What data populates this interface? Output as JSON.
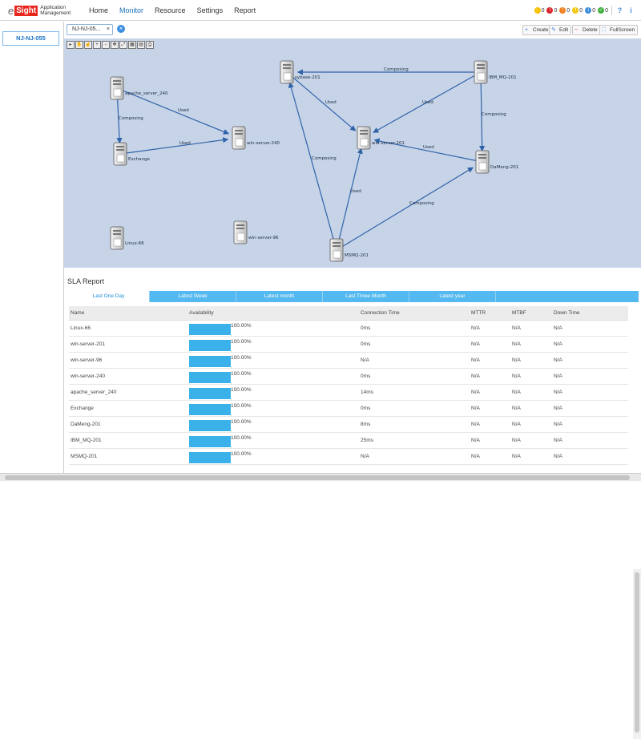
{
  "app": {
    "logo_prefix": "e",
    "logo_brand": "Sight",
    "product_line1": "Application",
    "product_line2": "Management"
  },
  "nav": [
    {
      "label": "Home"
    },
    {
      "label": "Monitor",
      "active": true
    },
    {
      "label": "Resource"
    },
    {
      "label": "Settings"
    },
    {
      "label": "Report"
    }
  ],
  "alarms": [
    {
      "count": "0",
      "color": "#f5c000",
      "icon": "lightning-icon"
    },
    {
      "count": "0",
      "color": "#d9262b",
      "icon": "critical-alarm-icon"
    },
    {
      "count": "0",
      "color": "#f07f1e",
      "icon": "major-alarm-icon"
    },
    {
      "count": "0",
      "color": "#f2c916",
      "icon": "minor-alarm-icon"
    },
    {
      "count": "0",
      "color": "#3d8ed8",
      "icon": "warning-alarm-icon"
    },
    {
      "count": "0",
      "color": "#3fae3b",
      "icon": "cleared-alarm-icon"
    }
  ],
  "left": {
    "node": "NJ-NJ-055"
  },
  "view_tab": {
    "label": "NJ-NJ-05...",
    "close": "×"
  },
  "toolbar": {
    "create": "Create",
    "edit": "Edit",
    "delete": "Delete",
    "fullscreen": "FullScreen"
  },
  "topology": {
    "nodes": [
      {
        "id": "apache",
        "label": "apache_server_240",
        "icon": "apache-server-icon"
      },
      {
        "id": "exchange",
        "label": "Exchange",
        "icon": "exchange-server-icon"
      },
      {
        "id": "ws240",
        "label": "win-server-240",
        "icon": "windows-server-icon"
      },
      {
        "id": "linux",
        "label": "Linux-66",
        "icon": "linux-server-icon"
      },
      {
        "id": "ws96",
        "label": "win-server-96",
        "icon": "windows-server-icon"
      },
      {
        "id": "sybase",
        "label": "sybase-201",
        "icon": "sybase-server-icon"
      },
      {
        "id": "ws201",
        "label": "win-server-201",
        "icon": "windows-server-icon"
      },
      {
        "id": "ibm",
        "label": "IBM_MQ-201",
        "icon": "ibm-mq-server-icon"
      },
      {
        "id": "dameng",
        "label": "DaMeng-201",
        "icon": "dameng-server-icon"
      },
      {
        "id": "msmq",
        "label": "MSMQ-201",
        "icon": "msmq-server-icon"
      }
    ],
    "links": [
      {
        "from": "apache",
        "to": "exchange",
        "label": "Composing"
      },
      {
        "from": "apache",
        "to": "ws240",
        "label": "Used"
      },
      {
        "from": "exchange",
        "to": "ws240",
        "label": "Used"
      },
      {
        "from": "ibm",
        "to": "sybase",
        "label": "Composing"
      },
      {
        "from": "sybase",
        "to": "ws201",
        "label": "Used"
      },
      {
        "from": "ibm",
        "to": "ws201",
        "label": "Used"
      },
      {
        "from": "ibm",
        "to": "dameng",
        "label": "Composing"
      },
      {
        "from": "dameng",
        "to": "ws201",
        "label": "Used"
      },
      {
        "from": "msmq",
        "to": "sybase",
        "label": "Composing"
      },
      {
        "from": "msmq",
        "to": "ws201",
        "label": "Used"
      },
      {
        "from": "msmq",
        "to": "dameng",
        "label": "Composing"
      }
    ]
  },
  "sla": {
    "title": "SLA Report",
    "tabs": [
      {
        "label": "Last One Day",
        "active": true
      },
      {
        "label": "Latest Week"
      },
      {
        "label": "Latest month"
      },
      {
        "label": "Last Three Month"
      },
      {
        "label": "Latest year"
      }
    ],
    "columns": [
      "Name",
      "Availability",
      "Connection Time",
      "MTTR",
      "MTBF",
      "Down Time"
    ],
    "rows": [
      {
        "name": "Linux-66",
        "availability": "100.00%",
        "availability_pct": 100,
        "conn": "0ms",
        "mttr": "N/A",
        "mtbf": "N/A",
        "down": "N/A"
      },
      {
        "name": "win-server-201",
        "availability": "100.00%",
        "availability_pct": 100,
        "conn": "0ms",
        "mttr": "N/A",
        "mtbf": "N/A",
        "down": "N/A"
      },
      {
        "name": "win-server-96",
        "availability": "100.00%",
        "availability_pct": 100,
        "conn": "N/A",
        "mttr": "N/A",
        "mtbf": "N/A",
        "down": "N/A"
      },
      {
        "name": "win-server-240",
        "availability": "100.00%",
        "availability_pct": 100,
        "conn": "0ms",
        "mttr": "N/A",
        "mtbf": "N/A",
        "down": "N/A"
      },
      {
        "name": "apache_server_240",
        "availability": "100.00%",
        "availability_pct": 100,
        "conn": "14ms",
        "mttr": "N/A",
        "mtbf": "N/A",
        "down": "N/A"
      },
      {
        "name": "Exchange",
        "availability": "100.00%",
        "availability_pct": 100,
        "conn": "0ms",
        "mttr": "N/A",
        "mtbf": "N/A",
        "down": "N/A"
      },
      {
        "name": "DaMeng-201",
        "availability": "100.00%",
        "availability_pct": 100,
        "conn": "8ms",
        "mttr": "N/A",
        "mtbf": "N/A",
        "down": "N/A"
      },
      {
        "name": "IBM_MQ-201",
        "availability": "100.00%",
        "availability_pct": 100,
        "conn": "25ms",
        "mttr": "N/A",
        "mtbf": "N/A",
        "down": "N/A"
      },
      {
        "name": "MSMQ-201",
        "availability": "100.00%",
        "availability_pct": 100,
        "conn": "N/A",
        "mttr": "N/A",
        "mtbf": "N/A",
        "down": "N/A"
      }
    ]
  }
}
